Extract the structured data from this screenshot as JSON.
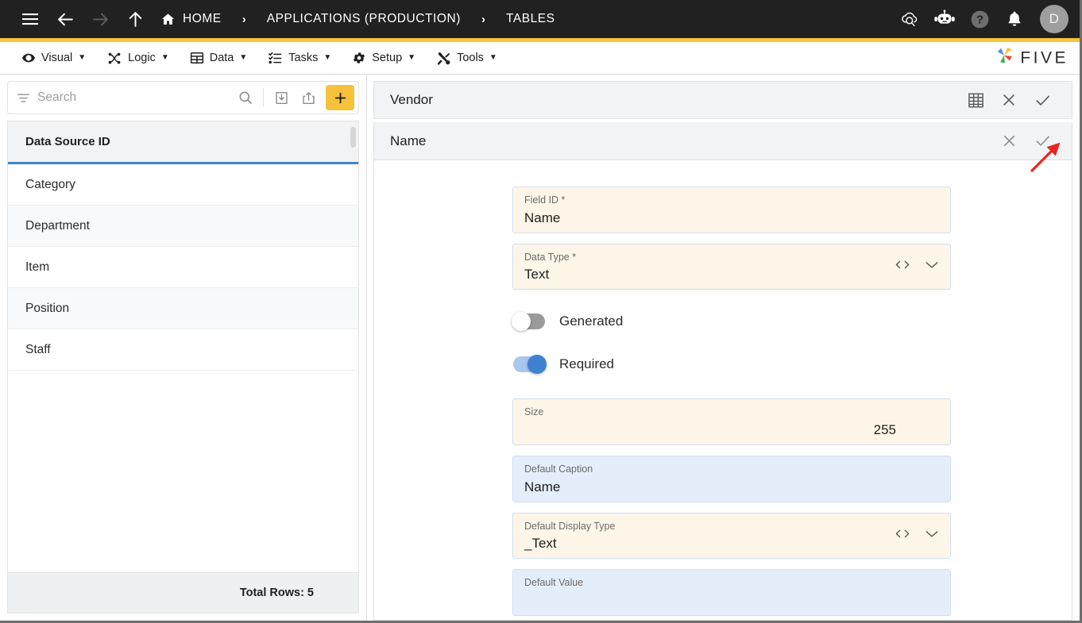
{
  "topbar": {
    "icons": [
      "hamburger-menu",
      "back-arrow",
      "forward-arrow",
      "up-arrow"
    ],
    "breadcrumbs": [
      {
        "label": "HOME",
        "icon": "home-icon"
      },
      {
        "label": "APPLICATIONS (PRODUCTION)"
      },
      {
        "label": "TABLES"
      }
    ],
    "separator": "›",
    "right_icons": [
      "cloud-search-icon",
      "robot-chat-icon",
      "help-icon",
      "notification-bell-icon"
    ],
    "avatar_initial": "D",
    "accent_color": "#f6c53d",
    "background_color": "#212121"
  },
  "menubar": {
    "items": [
      {
        "label": "Visual",
        "icon": "eye-icon",
        "caret": "▼"
      },
      {
        "label": "Logic",
        "icon": "logic-nodes-icon",
        "caret": "▼"
      },
      {
        "label": "Data",
        "icon": "table-grid-icon",
        "caret": "▼"
      },
      {
        "label": "Tasks",
        "icon": "checklist-icon",
        "caret": "▼"
      },
      {
        "label": "Setup",
        "icon": "gear-icon",
        "caret": "▼"
      },
      {
        "label": "Tools",
        "icon": "wrench-screwdriver-icon",
        "caret": "▼"
      }
    ],
    "brand": "FIVE"
  },
  "sidebar": {
    "search": {
      "value": "",
      "placeholder": "Search"
    },
    "toolbar_icons": [
      "filter-icon",
      "search-icon",
      "import-icon",
      "export-icon",
      "add-icon"
    ],
    "add_label": "+",
    "list_header": "Data Source ID",
    "rows": [
      {
        "label": "Category"
      },
      {
        "label": "Department"
      },
      {
        "label": "Item"
      },
      {
        "label": "Position"
      },
      {
        "label": "Staff"
      }
    ],
    "footer": "Total Rows: 5"
  },
  "main": {
    "panel_title": "Vendor",
    "panel_icons": [
      "table-grid-icon",
      "close-icon",
      "confirm-check-icon"
    ],
    "sub_title": "Name",
    "sub_icons": [
      "close-icon",
      "confirm-check-icon"
    ],
    "fields": [
      {
        "label": "Field ID *",
        "value": "Name",
        "style": "cream",
        "align": "left",
        "has_code_icon": false,
        "has_chevron": false
      },
      {
        "label": "Data Type *",
        "value": "Text",
        "style": "cream",
        "align": "left",
        "has_code_icon": true,
        "has_chevron": true
      },
      {
        "label": "Size",
        "value": "255",
        "style": "cream",
        "align": "right",
        "has_code_icon": false,
        "has_chevron": false
      },
      {
        "label": "Default Caption",
        "value": "Name",
        "style": "blue",
        "align": "left",
        "has_code_icon": false,
        "has_chevron": false
      },
      {
        "label": "Default Display Type",
        "value": "_Text",
        "style": "cream",
        "align": "left",
        "has_code_icon": true,
        "has_chevron": true
      },
      {
        "label": "Default Value",
        "value": "",
        "style": "blue",
        "align": "left",
        "has_code_icon": false,
        "has_chevron": false
      }
    ],
    "toggles": [
      {
        "label": "Generated",
        "state": "off"
      },
      {
        "label": "Required",
        "state": "on"
      }
    ],
    "annotation": {
      "type": "red-arrow",
      "color": "#e8251f",
      "points_to": "confirm-check-icon"
    }
  }
}
